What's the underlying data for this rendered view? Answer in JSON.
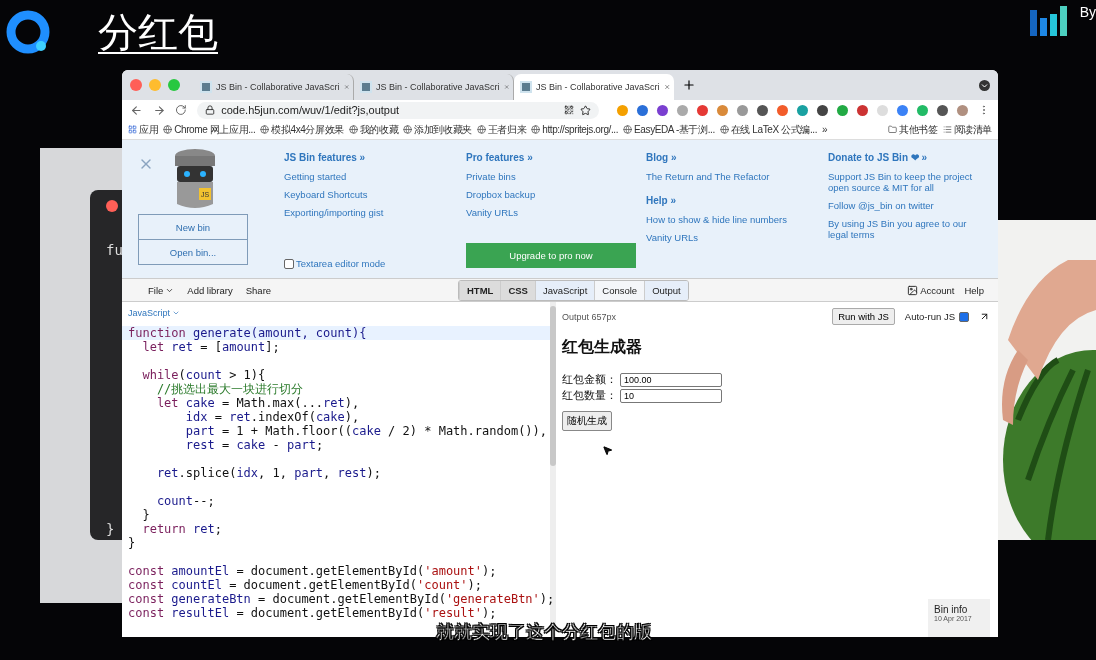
{
  "slide_title": "分红包",
  "corner_text": "By",
  "background_editor": {
    "lines": [
      "fu",
      "}"
    ]
  },
  "browser": {
    "tabs": [
      {
        "title": "JS Bin - Collaborative JavaScri",
        "selected": false
      },
      {
        "title": "JS Bin - Collaborative JavaScri",
        "selected": false
      },
      {
        "title": "JS Bin - Collaborative JavaScri",
        "selected": true
      }
    ],
    "address": "code.h5jun.com/wuv/1/edit?js,output",
    "bookmarks": [
      {
        "kind": "apps",
        "label": "应用"
      },
      {
        "kind": "link",
        "label": "Chrome 网上应用..."
      },
      {
        "kind": "link",
        "label": "模拟4x4分屏效果"
      },
      {
        "kind": "link",
        "label": "我的收藏"
      },
      {
        "kind": "link",
        "label": "添加到收藏夹"
      },
      {
        "kind": "link",
        "label": "王者归来"
      },
      {
        "kind": "link",
        "label": "http://spritejs.org/..."
      },
      {
        "kind": "link",
        "label": "EasyEDA -基于浏..."
      },
      {
        "kind": "link",
        "label": "在线 LaTeX 公式编..."
      },
      {
        "kind": "more",
        "label": "»"
      },
      {
        "kind": "folder",
        "label": "其他书签"
      },
      {
        "kind": "reading",
        "label": "阅读清单"
      }
    ]
  },
  "jsbin_panel": {
    "logo_badge": "JS",
    "buttons": [
      "New bin",
      "Open bin..."
    ],
    "columns": [
      {
        "sections": [
          {
            "heading": "JS Bin features »",
            "links": [
              "Getting started",
              "Keyboard Shortcuts",
              "Exporting/importing gist"
            ]
          }
        ],
        "checkbox": {
          "label": "Textarea editor mode",
          "checked": false
        }
      },
      {
        "sections": [
          {
            "heading": "Pro features »",
            "links": [
              "Private bins",
              "Dropbox backup",
              "Vanity URLs"
            ]
          }
        ],
        "button": "Upgrade to pro now"
      },
      {
        "sections": [
          {
            "heading": "Blog »",
            "links": [
              "The Return and The Refactor"
            ]
          },
          {
            "heading": "Help »",
            "links": [
              "How to show & hide line numbers",
              "Vanity URLs"
            ]
          }
        ]
      },
      {
        "sections": [
          {
            "heading": "Donate to JS Bin ❤ »",
            "links": [
              "Support JS Bin to keep the project open source & MIT for all",
              "Follow @js_bin on twitter",
              "By using JS Bin you agree to our legal terms"
            ]
          }
        ]
      }
    ]
  },
  "toolbar": {
    "left": [
      "File",
      "Add library",
      "Share"
    ],
    "panels": [
      {
        "label": "HTML",
        "selected": false,
        "bold": true
      },
      {
        "label": "CSS",
        "selected": false,
        "bold": true
      },
      {
        "label": "JavaScript",
        "selected": true,
        "bold": false
      },
      {
        "label": "Console",
        "selected": false,
        "bold": false
      },
      {
        "label": "Output",
        "selected": true,
        "bold": false
      }
    ],
    "account": "Account",
    "help": "Help"
  },
  "editor": {
    "language": "JavaScript",
    "lines": [
      {
        "kind": "code",
        "active": true,
        "tokens": [
          {
            "kind": "keyword",
            "text": "function"
          },
          {
            "kind": "name",
            "text": " generate(amount, count){"
          }
        ]
      },
      {
        "kind": "code",
        "active": false,
        "tokens": [
          {
            "kind": "keyword",
            "text": "  let"
          },
          {
            "kind": "name",
            "text": " ret "
          },
          {
            "kind": "plain",
            "text": "= ["
          },
          {
            "kind": "name",
            "text": "amount"
          },
          {
            "kind": "plain",
            "text": "];"
          }
        ]
      },
      {
        "kind": "blank"
      },
      {
        "kind": "code",
        "active": false,
        "tokens": [
          {
            "kind": "keyword",
            "text": "  while"
          },
          {
            "kind": "plain",
            "text": "("
          },
          {
            "kind": "name",
            "text": "count"
          },
          {
            "kind": "plain",
            "text": " > 1){"
          }
        ]
      },
      {
        "kind": "code",
        "active": false,
        "tokens": [
          {
            "kind": "comment",
            "text": "    //挑选出最大一块进行切分"
          }
        ]
      },
      {
        "kind": "code",
        "active": false,
        "tokens": [
          {
            "kind": "keyword",
            "text": "    let"
          },
          {
            "kind": "name",
            "text": " cake "
          },
          {
            "kind": "plain",
            "text": "= Math.max(..."
          },
          {
            "kind": "name",
            "text": "ret"
          },
          {
            "kind": "plain",
            "text": "),"
          }
        ]
      },
      {
        "kind": "code",
        "active": false,
        "tokens": [
          {
            "kind": "name",
            "text": "        idx "
          },
          {
            "kind": "plain",
            "text": "= "
          },
          {
            "kind": "name",
            "text": "ret"
          },
          {
            "kind": "plain",
            "text": ".indexOf("
          },
          {
            "kind": "name",
            "text": "cake"
          },
          {
            "kind": "plain",
            "text": "),"
          }
        ]
      },
      {
        "kind": "code",
        "active": false,
        "tokens": [
          {
            "kind": "name",
            "text": "        part "
          },
          {
            "kind": "plain",
            "text": "= 1 + Math.floor(("
          },
          {
            "kind": "name",
            "text": "cake"
          },
          {
            "kind": "plain",
            "text": " / 2) * Math.random()),"
          }
        ]
      },
      {
        "kind": "code",
        "active": false,
        "tokens": [
          {
            "kind": "name",
            "text": "        rest "
          },
          {
            "kind": "plain",
            "text": "= "
          },
          {
            "kind": "name",
            "text": "cake"
          },
          {
            "kind": "plain",
            "text": " - "
          },
          {
            "kind": "name",
            "text": "part"
          },
          {
            "kind": "plain",
            "text": ";"
          }
        ]
      },
      {
        "kind": "blank"
      },
      {
        "kind": "code",
        "active": false,
        "tokens": [
          {
            "kind": "name",
            "text": "    ret"
          },
          {
            "kind": "plain",
            "text": ".splice("
          },
          {
            "kind": "name",
            "text": "idx"
          },
          {
            "kind": "plain",
            "text": ", 1, "
          },
          {
            "kind": "name",
            "text": "part"
          },
          {
            "kind": "plain",
            "text": ", "
          },
          {
            "kind": "name",
            "text": "rest"
          },
          {
            "kind": "plain",
            "text": ");"
          }
        ]
      },
      {
        "kind": "blank"
      },
      {
        "kind": "code",
        "active": false,
        "tokens": [
          {
            "kind": "name",
            "text": "    count"
          },
          {
            "kind": "plain",
            "text": "--;"
          }
        ]
      },
      {
        "kind": "code",
        "active": false,
        "tokens": [
          {
            "kind": "plain",
            "text": "  }"
          }
        ]
      },
      {
        "kind": "code",
        "active": false,
        "tokens": [
          {
            "kind": "keyword",
            "text": "  return"
          },
          {
            "kind": "name",
            "text": " ret"
          },
          {
            "kind": "plain",
            "text": ";"
          }
        ]
      },
      {
        "kind": "code",
        "active": false,
        "tokens": [
          {
            "kind": "plain",
            "text": "}"
          }
        ]
      },
      {
        "kind": "blank"
      },
      {
        "kind": "code",
        "active": false,
        "tokens": [
          {
            "kind": "keyword",
            "text": "const"
          },
          {
            "kind": "name",
            "text": " amountEl "
          },
          {
            "kind": "plain",
            "text": "= document.getElementById("
          },
          {
            "kind": "string",
            "text": "'amount'"
          },
          {
            "kind": "plain",
            "text": ");"
          }
        ]
      },
      {
        "kind": "code",
        "active": false,
        "tokens": [
          {
            "kind": "keyword",
            "text": "const"
          },
          {
            "kind": "name",
            "text": " countEl "
          },
          {
            "kind": "plain",
            "text": "= document.getElementById("
          },
          {
            "kind": "string",
            "text": "'count'"
          },
          {
            "kind": "plain",
            "text": ");"
          }
        ]
      },
      {
        "kind": "code",
        "active": false,
        "tokens": [
          {
            "kind": "keyword",
            "text": "const"
          },
          {
            "kind": "name",
            "text": " generateBtn "
          },
          {
            "kind": "plain",
            "text": "= document.getElementById("
          },
          {
            "kind": "string",
            "text": "'generateBtn'"
          },
          {
            "kind": "plain",
            "text": ");"
          }
        ]
      },
      {
        "kind": "code",
        "active": false,
        "tokens": [
          {
            "kind": "keyword",
            "text": "const"
          },
          {
            "kind": "name",
            "text": " resultEl "
          },
          {
            "kind": "plain",
            "text": "= document.getElementById("
          },
          {
            "kind": "string",
            "text": "'result'"
          },
          {
            "kind": "plain",
            "text": ");"
          }
        ]
      }
    ]
  },
  "output": {
    "size_label": "Output 657px",
    "run_button": "Run with JS",
    "autorun": {
      "label": "Auto-run JS",
      "checked": true
    },
    "heading": "红包生成器",
    "fields": [
      {
        "label": "红包金额：",
        "value": "100.00"
      },
      {
        "label": "红包数量：",
        "value": "10"
      }
    ],
    "button": "随机生成",
    "bin_info": {
      "title": "Bin info",
      "date": "10 Apr 2017"
    }
  },
  "subtitle": "就就实现了这个分红包的版"
}
